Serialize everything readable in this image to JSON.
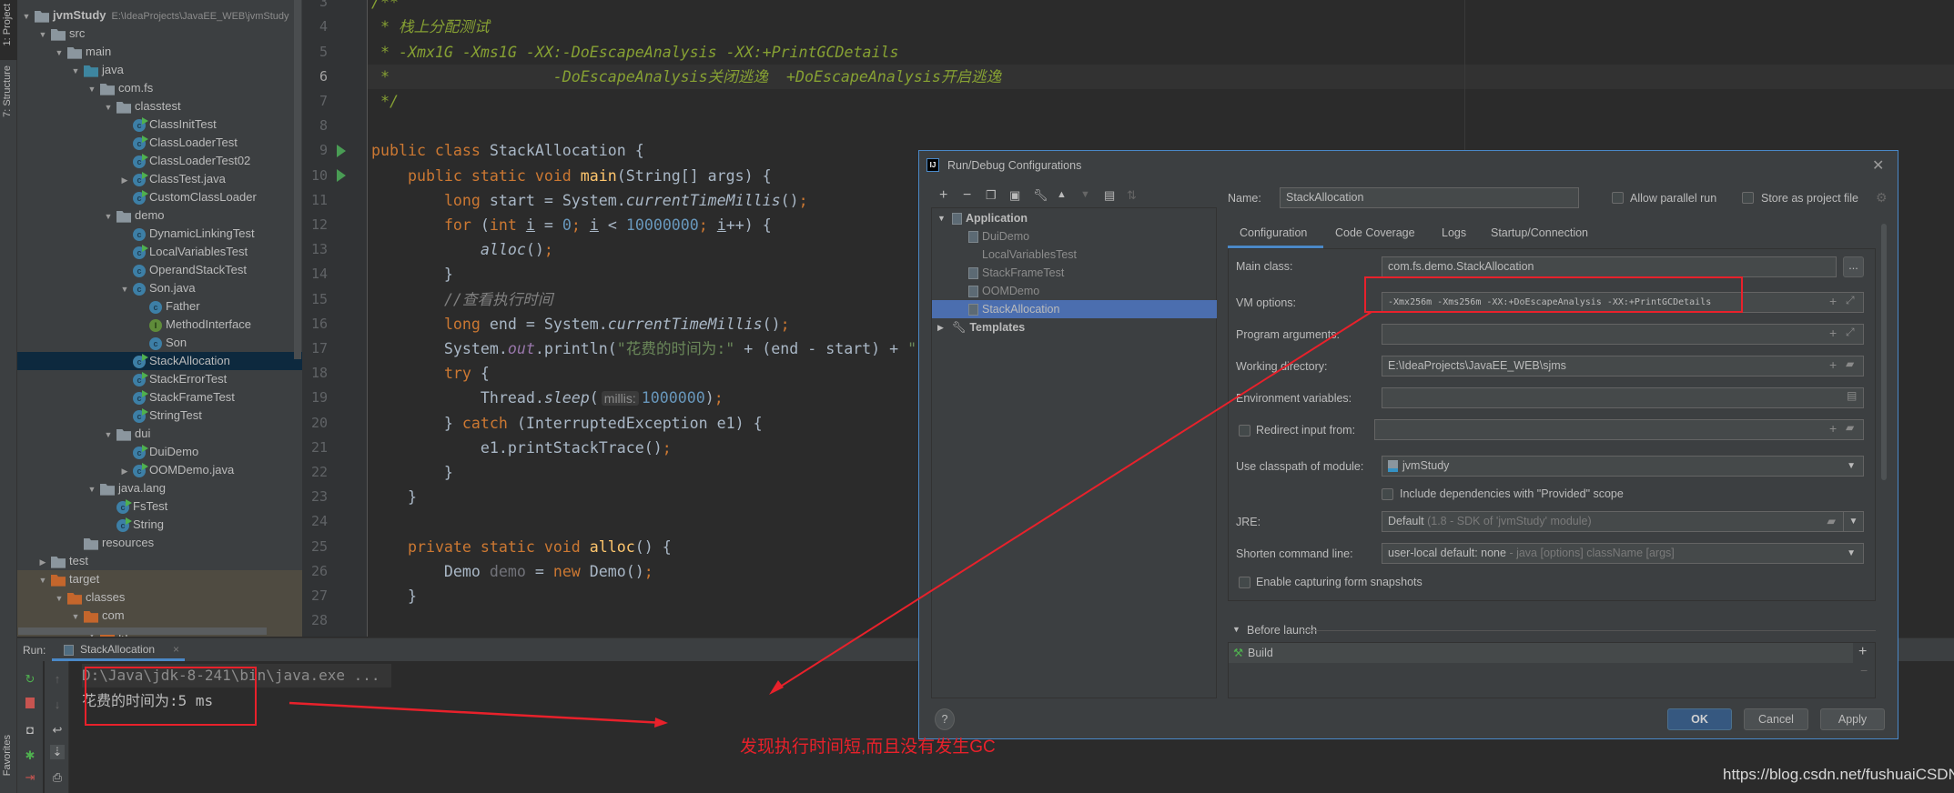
{
  "toolstrip": {
    "project_tab": "1: Project",
    "structure_tab": "7: Structure",
    "favorites_tab": "Favorites"
  },
  "project_tree": {
    "items": [
      {
        "label": "jvmStudy",
        "path": "E:\\IdeaProjects\\JavaEE_WEB\\jvmStudy",
        "level": 0,
        "icon": "module-folder",
        "arrow": "expanded",
        "bold": true
      },
      {
        "label": "src",
        "level": 1,
        "icon": "folder",
        "arrow": "expanded"
      },
      {
        "label": "main",
        "level": 2,
        "icon": "folder",
        "arrow": "expanded"
      },
      {
        "label": "java",
        "level": 3,
        "icon": "source-folder",
        "arrow": "expanded"
      },
      {
        "label": "com.fs",
        "level": 4,
        "icon": "package",
        "arrow": "expanded"
      },
      {
        "label": "classtest",
        "level": 5,
        "icon": "package",
        "arrow": "expanded"
      },
      {
        "label": "ClassInitTest",
        "level": 6,
        "icon": "class-runnable"
      },
      {
        "label": "ClassLoaderTest",
        "level": 6,
        "icon": "class-runnable"
      },
      {
        "label": "ClassLoaderTest02",
        "level": 6,
        "icon": "class-runnable"
      },
      {
        "label": "ClassTest.java",
        "level": 6,
        "icon": "class-runnable",
        "arrow": "collapsed"
      },
      {
        "label": "CustomClassLoader",
        "level": 6,
        "icon": "class-runnable"
      },
      {
        "label": "demo",
        "level": 5,
        "icon": "package",
        "arrow": "expanded"
      },
      {
        "label": "DynamicLinkingTest",
        "level": 6,
        "icon": "class"
      },
      {
        "label": "LocalVariablesTest",
        "level": 6,
        "icon": "class-runnable"
      },
      {
        "label": "OperandStackTest",
        "level": 6,
        "icon": "class"
      },
      {
        "label": "Son.java",
        "level": 6,
        "icon": "class",
        "arrow": "expanded"
      },
      {
        "label": "Father",
        "level": 7,
        "icon": "class"
      },
      {
        "label": "MethodInterface",
        "level": 7,
        "icon": "interface"
      },
      {
        "label": "Son",
        "level": 7,
        "icon": "class"
      },
      {
        "label": "StackAllocation",
        "level": 6,
        "icon": "class-runnable",
        "selected": true
      },
      {
        "label": "StackErrorTest",
        "level": 6,
        "icon": "class-runnable"
      },
      {
        "label": "StackFrameTest",
        "level": 6,
        "icon": "class-runnable"
      },
      {
        "label": "StringTest",
        "level": 6,
        "icon": "class-runnable"
      },
      {
        "label": "dui",
        "level": 5,
        "icon": "package",
        "arrow": "expanded"
      },
      {
        "label": "DuiDemo",
        "level": 6,
        "icon": "class-runnable"
      },
      {
        "label": "OOMDemo.java",
        "level": 6,
        "icon": "class-runnable",
        "arrow": "collapsed"
      },
      {
        "label": "java.lang",
        "level": 4,
        "icon": "package",
        "arrow": "expanded"
      },
      {
        "label": "FsTest",
        "level": 5,
        "icon": "class-runnable"
      },
      {
        "label": "String",
        "level": 5,
        "icon": "class-runnable"
      },
      {
        "label": "resources",
        "level": 3,
        "icon": "resources-folder"
      },
      {
        "label": "test",
        "level": 1,
        "icon": "folder",
        "arrow": "collapsed"
      },
      {
        "label": "target",
        "level": 1,
        "icon": "excluded-folder",
        "arrow": "expanded",
        "excluded": true
      },
      {
        "label": "classes",
        "level": 2,
        "icon": "excluded-folder",
        "arrow": "expanded",
        "excluded": true
      },
      {
        "label": "com",
        "level": 3,
        "icon": "excluded-folder",
        "arrow": "expanded",
        "excluded": true
      },
      {
        "label": "fs",
        "level": 4,
        "icon": "excluded-folder",
        "arrow": "expanded",
        "excluded": true
      }
    ]
  },
  "editor": {
    "current_line": 6,
    "run_gutter_lines": [
      9,
      10
    ],
    "lines": [
      {
        "n": 3,
        "tokens": [
          [
            "/**",
            "dc"
          ]
        ]
      },
      {
        "n": 4,
        "tokens": [
          [
            " * 栈上分配测试",
            "dc"
          ]
        ]
      },
      {
        "n": 5,
        "tokens": [
          [
            " * -Xmx1G -Xms1G -XX:-DoEscapeAnalysis -XX:+PrintGCDetails",
            "dc"
          ]
        ]
      },
      {
        "n": 6,
        "tokens": [
          [
            " *                  -DoEscapeAnalysis关闭逃逸  +DoEscapeAnalysis开启逃逸",
            "dc"
          ]
        ]
      },
      {
        "n": 7,
        "tokens": [
          [
            " */",
            "dc"
          ]
        ]
      },
      {
        "n": 8,
        "tokens": []
      },
      {
        "n": 9,
        "tokens": [
          [
            "public class",
            "k"
          ],
          [
            " StackAllocation {",
            "t"
          ]
        ]
      },
      {
        "n": 10,
        "tokens": [
          [
            "    ",
            "t"
          ],
          [
            "public static void",
            "k"
          ],
          [
            " ",
            "t"
          ],
          [
            "main",
            "f"
          ],
          [
            "(String[] args) {",
            "t"
          ]
        ]
      },
      {
        "n": 11,
        "tokens": [
          [
            "        ",
            "t"
          ],
          [
            "long",
            "k"
          ],
          [
            " start = System.",
            "t"
          ],
          [
            "currentTimeMillis",
            "i"
          ],
          [
            "()",
            "t"
          ],
          [
            ";",
            "k"
          ]
        ]
      },
      {
        "n": 12,
        "tokens": [
          [
            "        ",
            "t"
          ],
          [
            "for",
            "k"
          ],
          [
            " (",
            "t"
          ],
          [
            "int",
            "k"
          ],
          [
            " ",
            "t"
          ],
          [
            "i",
            "u"
          ],
          [
            " = ",
            "t"
          ],
          [
            "0",
            "n"
          ],
          [
            ";",
            "k"
          ],
          [
            " ",
            "t"
          ],
          [
            "i",
            "u"
          ],
          [
            " < ",
            "t"
          ],
          [
            "10000000",
            "n"
          ],
          [
            ";",
            "k"
          ],
          [
            " ",
            "t"
          ],
          [
            "i",
            "u"
          ],
          [
            "++) {",
            "t"
          ]
        ]
      },
      {
        "n": 13,
        "tokens": [
          [
            "            ",
            "t"
          ],
          [
            "alloc",
            "i"
          ],
          [
            "()",
            "t"
          ],
          [
            ";",
            "k"
          ]
        ]
      },
      {
        "n": 14,
        "tokens": [
          [
            "        }",
            "t"
          ]
        ]
      },
      {
        "n": 15,
        "tokens": [
          [
            "        ",
            "t"
          ],
          [
            "//查看执行时间",
            "c"
          ]
        ]
      },
      {
        "n": 16,
        "tokens": [
          [
            "        ",
            "t"
          ],
          [
            "long",
            "k"
          ],
          [
            " end = System.",
            "t"
          ],
          [
            "currentTimeMillis",
            "i"
          ],
          [
            "()",
            "t"
          ],
          [
            ";",
            "k"
          ]
        ]
      },
      {
        "n": 17,
        "tokens": [
          [
            "        System.",
            "t"
          ],
          [
            "out",
            "o"
          ],
          [
            ".println(",
            "t"
          ],
          [
            "\"花费的时间为:\"",
            "s"
          ],
          [
            " + (end - start) + ",
            "t"
          ],
          [
            "\"",
            "s"
          ]
        ]
      },
      {
        "n": 18,
        "tokens": [
          [
            "        ",
            "t"
          ],
          [
            "try",
            "k"
          ],
          [
            " {",
            "t"
          ]
        ]
      },
      {
        "n": 19,
        "tokens": [
          [
            "            Thread.",
            "t"
          ],
          [
            "sleep",
            "i"
          ],
          [
            "(",
            "t"
          ],
          [
            "millis:",
            "h"
          ],
          [
            "1000000",
            "n"
          ],
          [
            ")",
            "t"
          ],
          [
            ";",
            "k"
          ]
        ]
      },
      {
        "n": 20,
        "tokens": [
          [
            "        } ",
            "t"
          ],
          [
            "catch",
            "k"
          ],
          [
            " (InterruptedException e1) {",
            "t"
          ]
        ]
      },
      {
        "n": 21,
        "tokens": [
          [
            "            e1.printStackTrace()",
            "t"
          ],
          [
            ";",
            "k"
          ]
        ]
      },
      {
        "n": 22,
        "tokens": [
          [
            "        }",
            "t"
          ]
        ]
      },
      {
        "n": 23,
        "tokens": [
          [
            "    }",
            "t"
          ]
        ]
      },
      {
        "n": 24,
        "tokens": []
      },
      {
        "n": 25,
        "tokens": [
          [
            "    ",
            "t"
          ],
          [
            "private static void",
            "k"
          ],
          [
            " ",
            "t"
          ],
          [
            "alloc",
            "f"
          ],
          [
            "() {",
            "t"
          ]
        ]
      },
      {
        "n": 26,
        "tokens": [
          [
            "        Demo ",
            "t"
          ],
          [
            "demo",
            "g"
          ],
          [
            " = ",
            "t"
          ],
          [
            "new",
            "k"
          ],
          [
            " Demo()",
            "t"
          ],
          [
            ";",
            "k"
          ]
        ]
      },
      {
        "n": 27,
        "tokens": [
          [
            "    }",
            "t"
          ]
        ]
      },
      {
        "n": 28,
        "tokens": []
      }
    ]
  },
  "run_panel": {
    "label": "Run:",
    "tab": "StackAllocation",
    "console_lines": [
      "D:\\Java\\jdk-8-241\\bin\\java.exe ...",
      "花费的时间为:5 ms"
    ]
  },
  "dialog": {
    "title": "Run/Debug Configurations",
    "tree": {
      "group": "Application",
      "items": [
        "DuiDemo",
        "LocalVariablesTest",
        "StackFrameTest",
        "OOMDemo",
        "StackAllocation"
      ],
      "selected": "StackAllocation",
      "templates": "Templates"
    },
    "name_label": "Name:",
    "name_value": "StackAllocation",
    "allow_parallel_run": {
      "label": "Allow parallel run",
      "checked": false
    },
    "store_as_project_file": {
      "label": "Store as project file",
      "checked": false
    },
    "tabs": [
      "Configuration",
      "Code Coverage",
      "Logs",
      "Startup/Connection"
    ],
    "active_tab": "Configuration",
    "fields": {
      "main_class": {
        "label": "Main class:",
        "value": "com.fs.demo.StackAllocation",
        "button": "..."
      },
      "vm_options": {
        "label": "VM options:",
        "value": "-Xmx256m -Xms256m -XX:+DoEscapeAnalysis -XX:+PrintGCDetails"
      },
      "program_arguments": {
        "label": "Program arguments:",
        "value": ""
      },
      "working_directory": {
        "label": "Working directory:",
        "value": "E:\\IdeaProjects\\JavaEE_WEB\\sjms"
      },
      "environment_variables": {
        "label": "Environment variables:",
        "value": ""
      },
      "redirect_input": {
        "label": "Redirect input from:",
        "checked": false,
        "value": ""
      },
      "classpath_module": {
        "label": "Use classpath of module:",
        "value": "jvmStudy"
      },
      "include_provided": {
        "label": "Include dependencies with \"Provided\" scope",
        "checked": false
      },
      "jre": {
        "label": "JRE:",
        "value": "Default",
        "hint": "(1.8 - SDK of 'jvmStudy' module)"
      },
      "shorten_command_line": {
        "label": "Shorten command line:",
        "value": "user-local default: none",
        "hint": "- java [options] className [args]"
      },
      "form_snapshots": {
        "label": "Enable capturing form snapshots",
        "checked": false
      }
    },
    "before_launch": {
      "label": "Before launch",
      "items": [
        "Build"
      ]
    },
    "buttons": {
      "help": "?",
      "ok": "OK",
      "cancel": "Cancel",
      "apply": "Apply"
    }
  },
  "annotation": {
    "note": "发现执行时间短,而且没有发生GC",
    "color": "#e8212b"
  },
  "watermark": "https://blog.csdn.net/fushuaiCSDN"
}
